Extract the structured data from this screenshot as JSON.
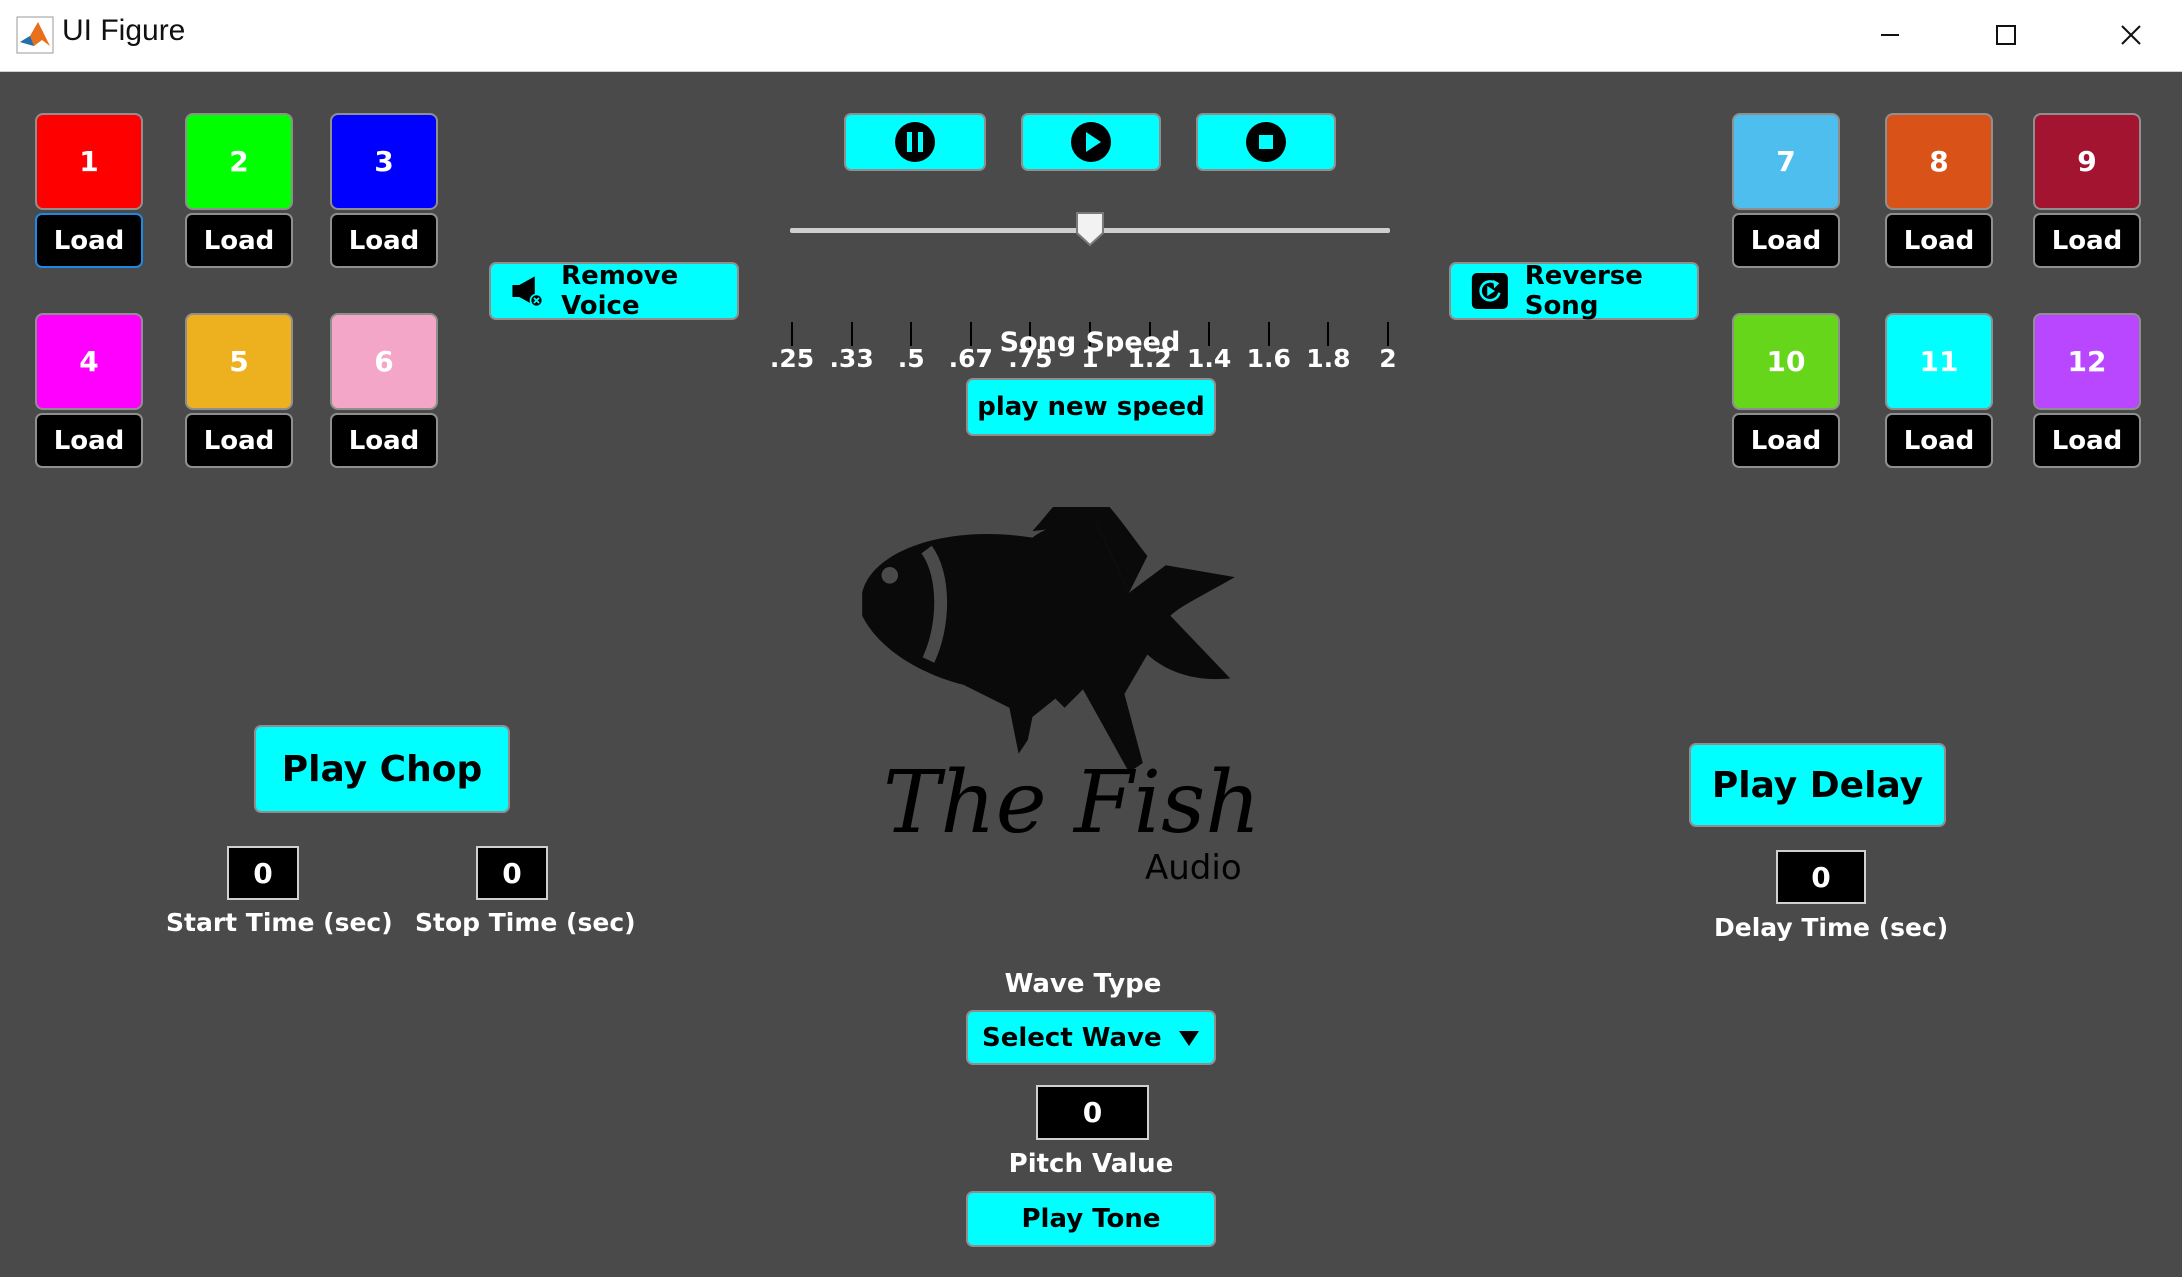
{
  "window": {
    "title": "UI Figure"
  },
  "pads_left": [
    {
      "label": "1",
      "color": "#ff0000",
      "load": "Load"
    },
    {
      "label": "2",
      "color": "#00ff00",
      "load": "Load"
    },
    {
      "label": "3",
      "color": "#0000ff",
      "load": "Load"
    },
    {
      "label": "4",
      "color": "#ff00ff",
      "load": "Load"
    },
    {
      "label": "5",
      "color": "#edb120",
      "load": "Load"
    },
    {
      "label": "6",
      "color": "#f4a6c8",
      "load": "Load"
    }
  ],
  "pads_right": [
    {
      "label": "7",
      "color": "#4dbeee",
      "load": "Load"
    },
    {
      "label": "8",
      "color": "#d95319",
      "load": "Load"
    },
    {
      "label": "9",
      "color": "#a2142f",
      "load": "Load"
    },
    {
      "label": "10",
      "color": "#66d61a",
      "load": "Load"
    },
    {
      "label": "11",
      "color": "#00ffff",
      "load": "Load"
    },
    {
      "label": "12",
      "color": "#b847ff",
      "load": "Load"
    }
  ],
  "transport": {
    "pause": "pause-icon",
    "play": "play-icon",
    "stop": "stop-icon"
  },
  "speed": {
    "ticks": [
      ".25",
      ".33",
      ".5",
      ".67",
      ".75",
      "1",
      "1.2",
      "1.4",
      "1.6",
      "1.8",
      "2"
    ],
    "value": "1",
    "label": "Song Speed",
    "play_new_speed": "play new speed"
  },
  "remove_voice": "Remove Voice",
  "reverse_song": "Reverse Song",
  "logo": {
    "line1": "The Fish",
    "line2": "Audio"
  },
  "chop": {
    "button": "Play Chop",
    "start_value": "0",
    "start_label": "Start Time (sec)",
    "stop_value": "0",
    "stop_label": "Stop Time (sec)"
  },
  "delay": {
    "button": "Play Delay",
    "value": "0",
    "label": "Delay Time (sec)"
  },
  "wave": {
    "label": "Wave Type",
    "selected": "Select Wave",
    "pitch_value": "0",
    "pitch_label": "Pitch Value",
    "play_tone": "Play Tone"
  },
  "colors": {
    "background": "#4a4a4a",
    "accent": "#00ffff"
  }
}
